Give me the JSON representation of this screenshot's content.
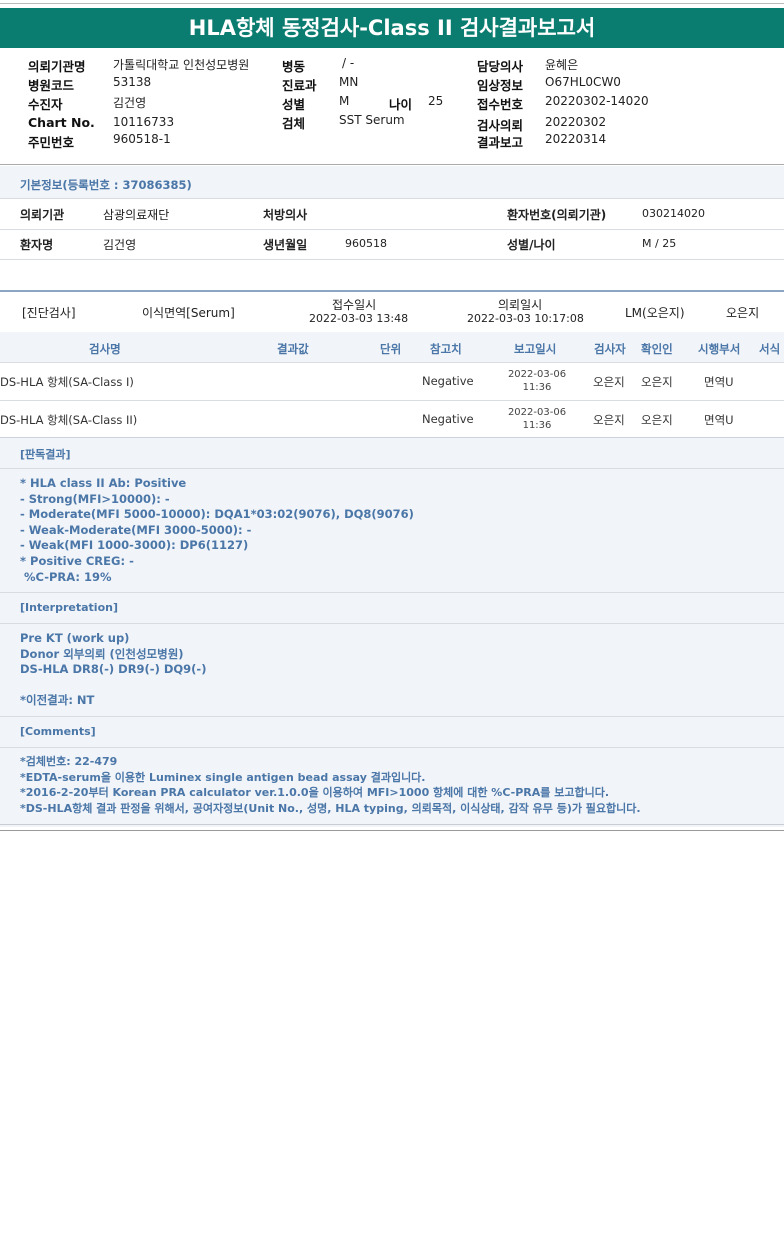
{
  "title": "HLA항체 동정검사-Class II 검사결과보고서",
  "header_info": {
    "col1": [
      {
        "label": "의뢰기관명",
        "value": "가톨릭대학교 인천성모병원"
      },
      {
        "label": "병원코드",
        "value": "53138"
      },
      {
        "label": "수진자",
        "value": "김건영"
      },
      {
        "label": "Chart No.",
        "value": "10116733"
      },
      {
        "label": "주민번호",
        "value": "960518-1"
      }
    ],
    "col2": [
      {
        "label": "병동",
        "value": "/ -"
      },
      {
        "label": "진료과",
        "value": "MN"
      },
      {
        "label": "성별",
        "value": "M"
      },
      {
        "label": "검체",
        "value": "SST Serum"
      }
    ],
    "age_label": "나이",
    "age_value": "25",
    "col3": [
      {
        "label": "담당의사",
        "value": "윤혜은"
      },
      {
        "label": "임상정보",
        "value": "O67HL0CW0"
      },
      {
        "label": "접수번호",
        "value": "20220302-14020"
      },
      {
        "label": "검사의뢰",
        "value": "20220302"
      },
      {
        "label": "결과보고",
        "value": "20220314"
      }
    ]
  },
  "basic_info": {
    "heading": "기본정보(등록번호 : 37086385)",
    "inst_label": "의뢰기관",
    "inst_value": "삼광의료재단",
    "doctor_label": "처방의사",
    "doctor_value": "",
    "patno_label": "환자번호(의뢰기관)",
    "patno_value": "030214020",
    "name_label": "환자명",
    "name_value": "김건영",
    "dob_label": "생년월일",
    "dob_value": "960518",
    "sexage_label": "성별/나이",
    "sexage_value": "M / 25"
  },
  "exam": {
    "type": "[진단검사]",
    "specimen": "이식면역[Serum]",
    "recv_label": "접수일시",
    "recv_value": "2022-03-03  13:48",
    "req_label": "의뢰일시",
    "req_value": "2022-03-03  10:17:08",
    "lm": "LM(오은지)",
    "person": "오은지"
  },
  "table": {
    "headers": [
      "검사명",
      "결과값",
      "단위",
      "참고치",
      "보고일시",
      "검사자",
      "확인인",
      "시행부서",
      "서식"
    ],
    "rows": [
      {
        "name": "DS-HLA 항체(SA-Class I)",
        "result": "",
        "unit": "",
        "ref": "Negative",
        "date": "2022-03-06",
        "time": "11:36",
        "tester": "오은지",
        "checker": "오은지",
        "dept": "면역U"
      },
      {
        "name": "DS-HLA 항체(SA-Class II)",
        "result": "",
        "unit": "",
        "ref": "Negative",
        "date": "2022-03-06",
        "time": "11:36",
        "tester": "오은지",
        "checker": "오은지",
        "dept": "면역U"
      }
    ]
  },
  "judgement": {
    "heading": "[판독결과]",
    "lines": [
      "* HLA class II Ab: Positive",
      "- Strong(MFI>10000): -",
      "- Moderate(MFI 5000-10000): DQA1*03:02(9076), DQ8(9076)",
      "- Weak-Moderate(MFI 3000-5000): -",
      "- Weak(MFI 1000-3000): DP6(1127)",
      "* Positive CREG: -",
      " %C-PRA: 19%"
    ]
  },
  "interpretation": {
    "heading": "[Interpretation]",
    "lines": [
      "Pre KT (work up)",
      "Donor 외부의뢰 (인천성모병원)",
      "DS-HLA DR8(-) DR9(-) DQ9(-)",
      "",
      "*이전결과: NT"
    ]
  },
  "comments": {
    "heading": "[Comments]",
    "lines": [
      "*검체번호: 22-479",
      "*EDTA-serum을 이용한 Luminex single antigen bead assay 결과입니다.",
      "*2016-2-20부터 Korean PRA calculator ver.1.0.0을 이용하여 MFI>1000 항체에 대한 %C-PRA를 보고합니다.",
      "*DS-HLA항체 결과 판정을 위해서, 공여자정보(Unit No., 성명, HLA typing, 의뢰목적, 이식상태, 감작 유무 등)가 필요합니다."
    ]
  }
}
